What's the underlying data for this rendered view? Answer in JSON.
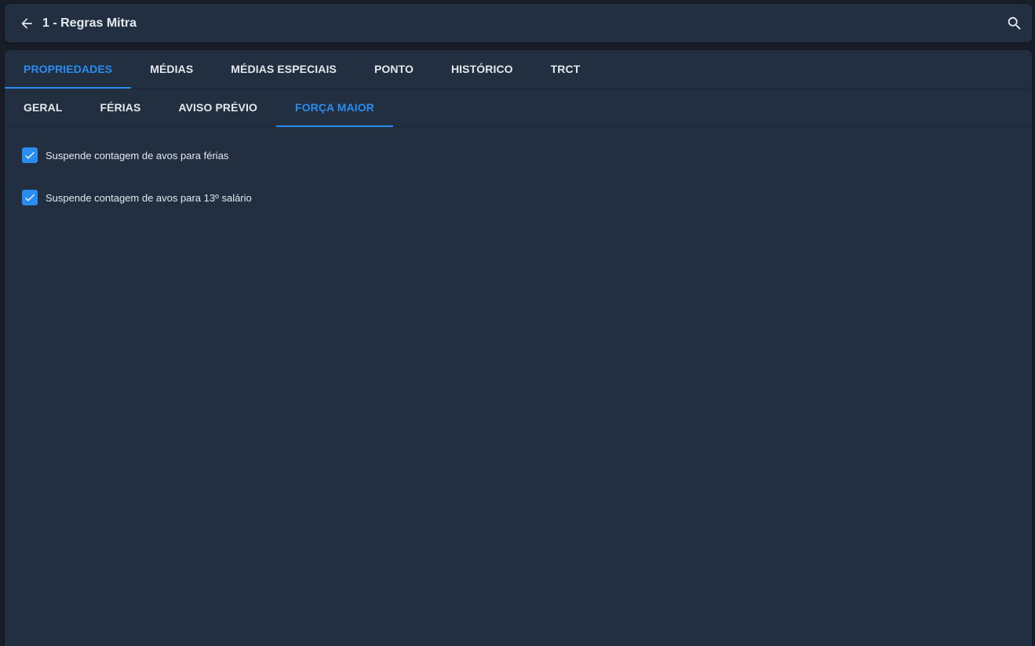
{
  "header": {
    "title": "1 - Regras Mitra",
    "back_icon": "arrow-left-icon",
    "search_icon": "search-icon"
  },
  "tabs": [
    {
      "label": "PROPRIEDADES",
      "active": true
    },
    {
      "label": "MÉDIAS",
      "active": false
    },
    {
      "label": "MÉDIAS ESPECIAIS",
      "active": false
    },
    {
      "label": "PONTO",
      "active": false
    },
    {
      "label": "HISTÓRICO",
      "active": false
    },
    {
      "label": "TRCT",
      "active": false
    }
  ],
  "subtabs": [
    {
      "label": "GERAL",
      "active": false
    },
    {
      "label": "FÉRIAS",
      "active": false
    },
    {
      "label": "AVISO PRÉVIO",
      "active": false
    },
    {
      "label": "FORÇA MAIOR",
      "active": true
    }
  ],
  "options": [
    {
      "label": "Suspende contagem de avos para férias",
      "checked": true
    },
    {
      "label": "Suspende contagem de avos para 13º salário",
      "checked": true
    }
  ],
  "colors": {
    "accent": "#2a8cf0",
    "panel": "#212f40",
    "background": "#171e27",
    "text": "#e3e8ee"
  }
}
